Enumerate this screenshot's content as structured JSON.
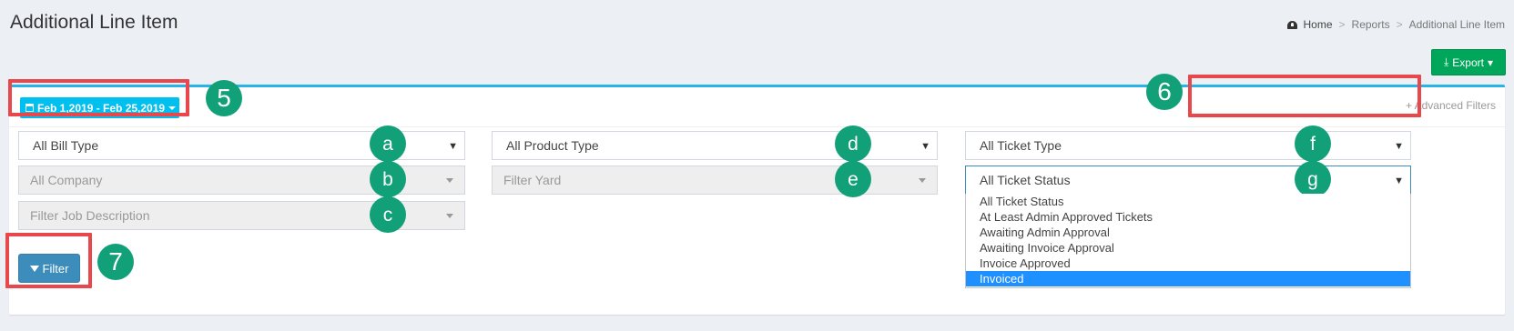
{
  "header": {
    "title": "Additional Line Item",
    "breadcrumb": [
      {
        "label": "Home",
        "icon": "dashboard-icon"
      },
      {
        "label": "Reports"
      },
      {
        "label": "Additional Line Item"
      }
    ],
    "separator": ">"
  },
  "toolbar": {
    "export_label": "Export"
  },
  "daterange": {
    "label": "Feb 1,2019 - Feb 25,2019"
  },
  "advanced_filters": {
    "label": "+ Advanced Filters"
  },
  "filters": {
    "bill_type": "All Bill Type",
    "company": "All Company",
    "job_description": "Filter Job Description",
    "product_type": "All Product Type",
    "yard": "Filter Yard",
    "ticket_type": "All Ticket Type",
    "ticket_status": "All Ticket Status"
  },
  "ticket_status_options": [
    "All Ticket Status",
    "At Least Admin Approved Tickets",
    "Awaiting Admin Approval",
    "Awaiting Invoice Approval",
    "Invoice Approved",
    "Invoiced"
  ],
  "ticket_status_highlighted": "Invoiced",
  "filter_button": {
    "label": "Filter"
  },
  "annotations": {
    "date_range": "5",
    "advanced_filters": "6",
    "filter_button": "7",
    "bill_type": "a",
    "company": "b",
    "job_description": "c",
    "product_type": "d",
    "yard": "e",
    "ticket_type": "f",
    "ticket_status": "g"
  },
  "colors": {
    "accent": "#29b4e8",
    "badge": "#11a077",
    "highlight_box": "#e8474b",
    "export": "#00a65a",
    "filter_button": "#3c8dbc",
    "option_highlight": "#1e90ff"
  }
}
